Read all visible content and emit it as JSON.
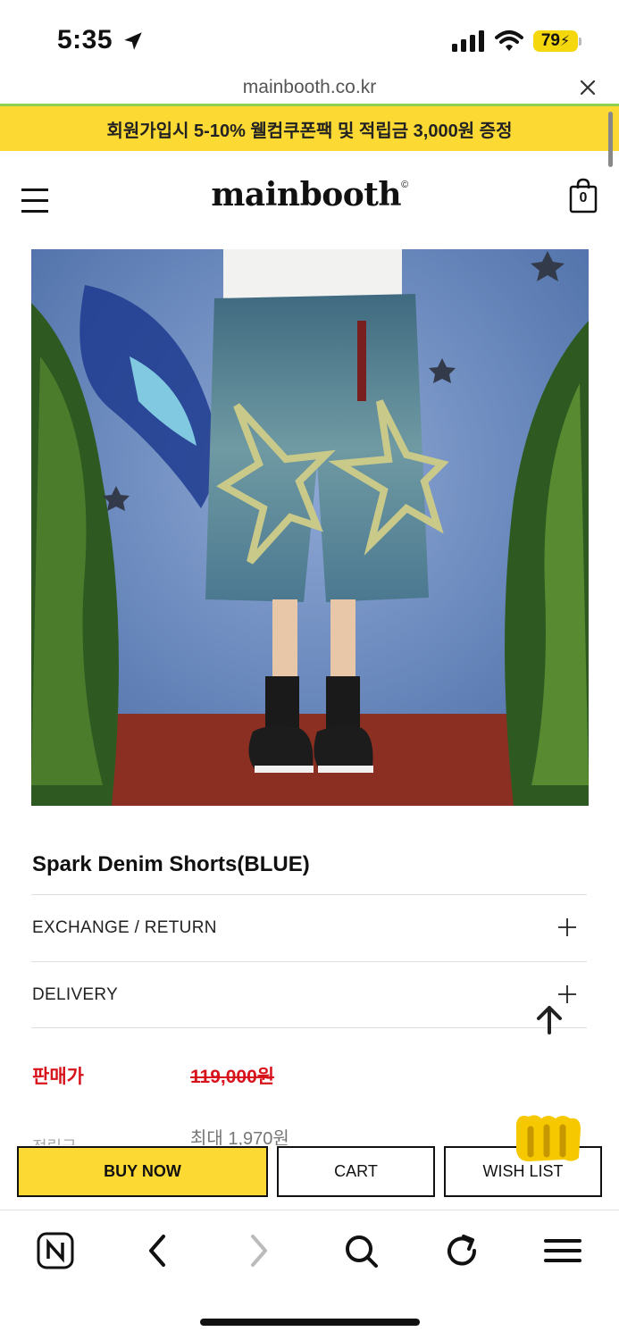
{
  "status_bar": {
    "time": "5:35",
    "battery": "79",
    "icons": [
      "location-arrow-icon",
      "cellular-signal-icon",
      "wifi-icon",
      "battery-icon"
    ]
  },
  "browser": {
    "url": "mainbooth.co.kr",
    "toolbar": [
      "naver-home-icon",
      "back-icon",
      "forward-icon",
      "search-icon",
      "reload-icon",
      "menu-icon"
    ]
  },
  "promo": {
    "text": "회원가입시 5-10% 웰컴쿠폰팩 및 적립금 3,000원 증정",
    "color": "#fdd933"
  },
  "header": {
    "logo": "mainbooth",
    "logo_mark": "©",
    "cart_count": "0"
  },
  "product": {
    "title": "Spark Denim Shorts(BLUE)",
    "image_icon": "product-photo",
    "accordions": [
      {
        "label": "EXCHANGE / RETURN"
      },
      {
        "label": "DELIVERY"
      }
    ],
    "price_label": "판매가",
    "price": "119,000원",
    "points_label": "적립금",
    "points_value": "최대 1,970원"
  },
  "actions": {
    "buy_now": "BUY NOW",
    "cart": "CART",
    "wish_list": "WISH LIST"
  },
  "colors": {
    "accent": "#fdd933",
    "price_red": "#d7141b"
  }
}
